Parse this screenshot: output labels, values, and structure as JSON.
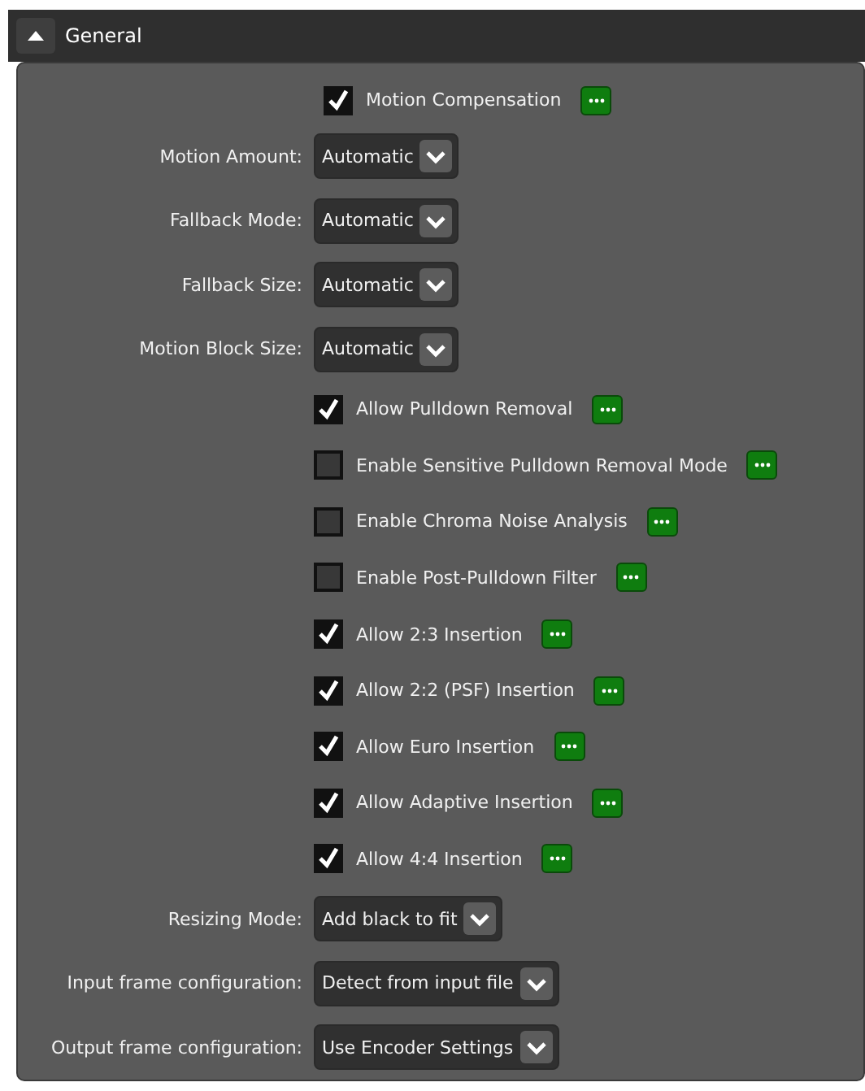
{
  "section": {
    "title": "General",
    "expanded": true
  },
  "items": [
    {
      "kind": "checkbox",
      "label": "Motion Compensation",
      "checked": true
    },
    {
      "kind": "dropdown",
      "label": "Motion Amount:",
      "value": "Automatic"
    },
    {
      "kind": "dropdown",
      "label": "Fallback Mode:",
      "value": "Automatic"
    },
    {
      "kind": "dropdown",
      "label": "Fallback Size:",
      "value": "Automatic"
    },
    {
      "kind": "dropdown",
      "label": "Motion Block Size:",
      "value": "Automatic"
    },
    {
      "kind": "checkbox",
      "label": "Allow Pulldown Removal",
      "checked": true
    },
    {
      "kind": "checkbox",
      "label": "Enable Sensitive Pulldown Removal Mode",
      "checked": false
    },
    {
      "kind": "checkbox",
      "label": "Enable Chroma Noise Analysis",
      "checked": false
    },
    {
      "kind": "checkbox",
      "label": "Enable Post-Pulldown Filter",
      "checked": false
    },
    {
      "kind": "checkbox",
      "label": "Allow 2:3 Insertion",
      "checked": true
    },
    {
      "kind": "checkbox",
      "label": "Allow 2:2 (PSF) Insertion",
      "checked": true
    },
    {
      "kind": "checkbox",
      "label": "Allow Euro Insertion",
      "checked": true
    },
    {
      "kind": "checkbox",
      "label": "Allow Adaptive Insertion",
      "checked": true
    },
    {
      "kind": "checkbox",
      "label": "Allow 4:4 Insertion",
      "checked": true
    },
    {
      "kind": "dropdown",
      "label": "Resizing Mode:",
      "value": "Add black to fit"
    },
    {
      "kind": "dropdown",
      "label": "Input frame configuration:",
      "value": "Detect from input file"
    },
    {
      "kind": "dropdown",
      "label": "Output frame configuration:",
      "value": "Use Encoder Settings"
    }
  ]
}
